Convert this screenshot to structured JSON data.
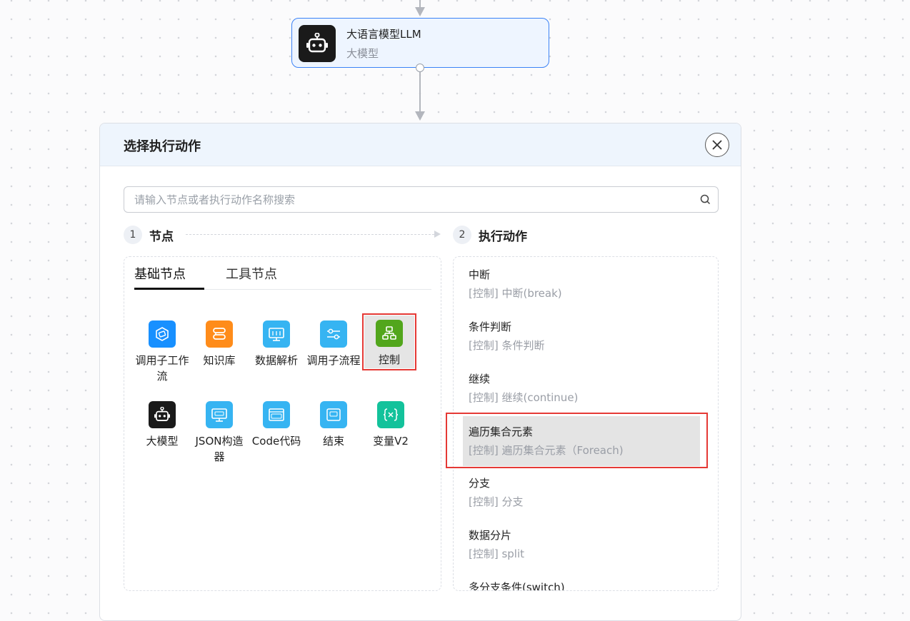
{
  "canvas": {
    "llm_node": {
      "title": "大语言模型LLM",
      "subtitle": "大模型",
      "icon": "robot-icon"
    }
  },
  "dialog": {
    "title": "选择执行动作",
    "close_icon": "close-icon",
    "search": {
      "placeholder": "请输入节点或者执行动作名称搜索",
      "value": "",
      "icon": "search-icon"
    },
    "steps": [
      {
        "number": "1",
        "label": "节点"
      },
      {
        "number": "2",
        "label": "执行动作"
      }
    ],
    "node_tabs": [
      {
        "label": "基础节点",
        "active": true
      },
      {
        "label": "工具节点",
        "active": false
      }
    ],
    "nodes": [
      {
        "label": "调用子工作流",
        "icon": "subworkflow-icon",
        "color": "#1890ff"
      },
      {
        "label": "知识库",
        "icon": "knowledge-base-icon",
        "color": "#ff8c1a"
      },
      {
        "label": "数据解析",
        "icon": "data-parse-icon",
        "color": "#36b4f2"
      },
      {
        "label": "调用子流程",
        "icon": "subprocess-icon",
        "color": "#36b4f2"
      },
      {
        "label": "控制",
        "icon": "control-icon",
        "color": "#52a61c",
        "selected": true
      },
      {
        "label": "大模型",
        "icon": "robot-icon",
        "color": "#1a1a1a"
      },
      {
        "label": "JSON构造器",
        "icon": "json-builder-icon",
        "color": "#36b4f2"
      },
      {
        "label": "Code代码",
        "icon": "code-icon",
        "color": "#36b4f2"
      },
      {
        "label": "结束",
        "icon": "api-end-icon",
        "color": "#36b4f2"
      },
      {
        "label": "变量V2",
        "icon": "variable-icon",
        "color": "#13c29b"
      }
    ],
    "actions": [
      {
        "name": "中断",
        "desc": "[控制] 中断(break)"
      },
      {
        "name": "条件判断",
        "desc": "[控制] 条件判断"
      },
      {
        "name": "继续",
        "desc": "[控制] 继续(continue)"
      },
      {
        "name": "遍历集合元素",
        "desc": "[控制] 遍历集合元素（Foreach)",
        "highlighted": true
      },
      {
        "name": "分支",
        "desc": "[控制] 分支"
      },
      {
        "name": "数据分片",
        "desc": "[控制] split"
      },
      {
        "name": "多分支条件(switch)",
        "desc": ""
      }
    ]
  }
}
